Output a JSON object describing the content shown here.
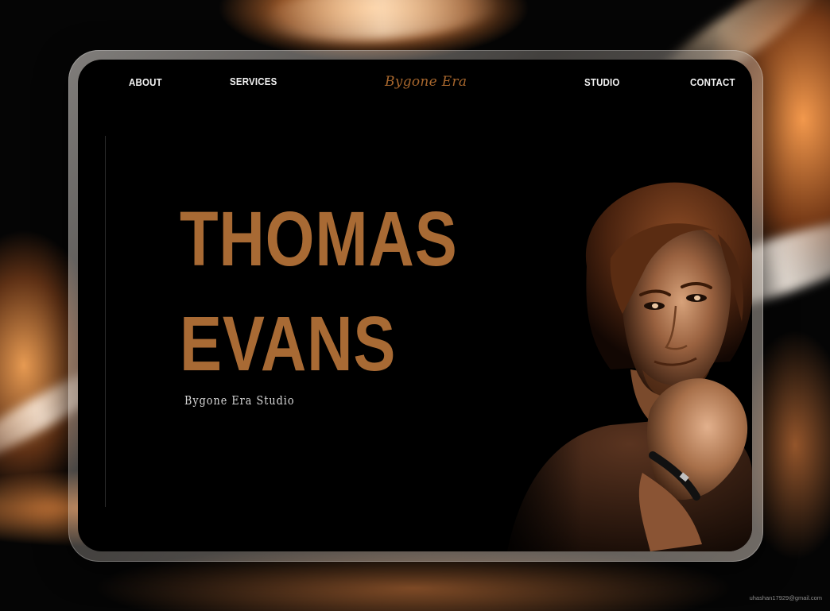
{
  "nav": {
    "about": "ABOUT",
    "services": "SERVICES",
    "logo": "Bygone Era",
    "studio": "STUDIO",
    "contact": "CONTACT"
  },
  "hero": {
    "name_line1": "THOMAS",
    "name_line2": "EVANS",
    "subtitle": "Bygone Era Studio"
  },
  "portrait": {
    "icon": "portrait-photo"
  },
  "credit": "uhashan17929@gmail.com",
  "colors": {
    "accent": "#a86a34",
    "logo": "#a8672d",
    "screen_bg": "#000000",
    "nav_text": "#f2f2f2",
    "subtitle_text": "#d9d9d9",
    "glow": "#f59a4a"
  }
}
